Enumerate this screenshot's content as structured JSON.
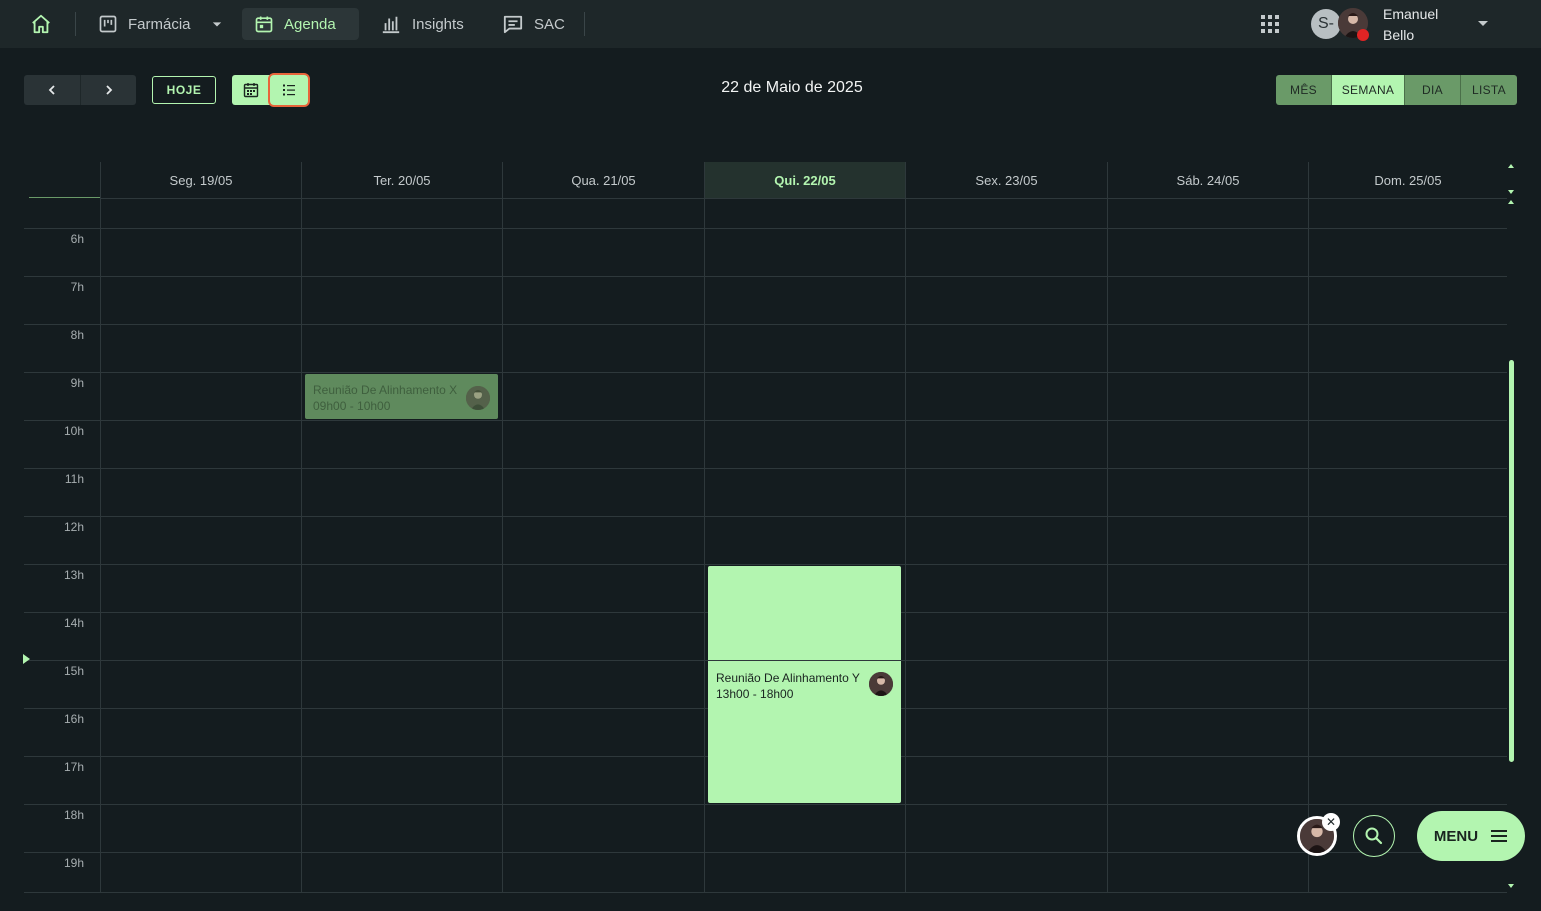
{
  "nav": {
    "home_icon": "home-icon",
    "items": [
      {
        "label": "Farmácia",
        "icon": "kanban-icon"
      },
      {
        "label": "Agenda",
        "icon": "calendar-icon"
      },
      {
        "label": "Insights",
        "icon": "bar-chart-icon"
      },
      {
        "label": "SAC",
        "icon": "chat-icon"
      }
    ],
    "user": {
      "initial": "S-",
      "name": "Emanuel Bello",
      "status_color": "#e02424"
    }
  },
  "toolbar": {
    "today_label": "HOJE",
    "date_title": "22 de Maio de 2025",
    "views": [
      "MÊS",
      "SEMANA",
      "DIA",
      "LISTA"
    ],
    "selected_view": "SEMANA"
  },
  "calendar": {
    "days": [
      "Seg. 19/05",
      "Ter. 20/05",
      "Qua. 21/05",
      "Qui. 22/05",
      "Sex. 23/05",
      "Sáb. 24/05",
      "Dom. 25/05"
    ],
    "today_index": 3,
    "hours": [
      "6h",
      "7h",
      "8h",
      "9h",
      "10h",
      "11h",
      "12h",
      "13h",
      "14h",
      "15h",
      "16h",
      "17h",
      "18h",
      "19h"
    ],
    "events": [
      {
        "title": "Reunião De Alinhamento X",
        "time": "09h00 - 10h00",
        "day": 1,
        "start": 9,
        "end": 10,
        "past": true
      },
      {
        "title": "Reunião De Alinhamento Y",
        "time": "13h00 - 18h00",
        "day": 3,
        "start": 13,
        "end": 18,
        "past": false
      }
    ]
  },
  "floating": {
    "menu_label": "MENU"
  },
  "colors": {
    "accent": "#b3f5b0",
    "background": "#141c1f",
    "topbar": "#1e2729"
  }
}
